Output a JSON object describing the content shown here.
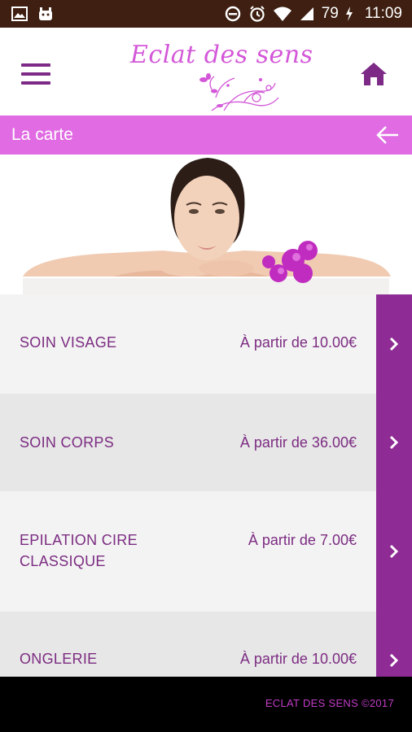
{
  "status_bar": {
    "battery": "79",
    "time": "11:09"
  },
  "header": {
    "logo_text": "Eclat des sens"
  },
  "title_bar": {
    "title": "La carte"
  },
  "services": [
    {
      "name_line1": "SOIN VISAGE",
      "name_line2": "",
      "price": "À partir de 10.00€"
    },
    {
      "name_line1": "SOIN CORPS",
      "name_line2": "",
      "price": "À partir de 36.00€"
    },
    {
      "name_line1": "EPILATION CIRE",
      "name_line2": "CLASSIQUE",
      "price": "À partir de 7.00€"
    },
    {
      "name_line1": "ONGLERIE",
      "name_line2": "",
      "price": "À partir de 10.00€"
    }
  ],
  "footer": {
    "copyright": "ECLAT DES SENS ©2017"
  },
  "colors": {
    "status_bar": "#3e1f11",
    "accent_purple": "#8e2b94",
    "title_bar": "#e06be3",
    "text_purple": "#7c2c82",
    "row_light": "#f3f3f3",
    "row_dark": "#e7e7e7"
  }
}
